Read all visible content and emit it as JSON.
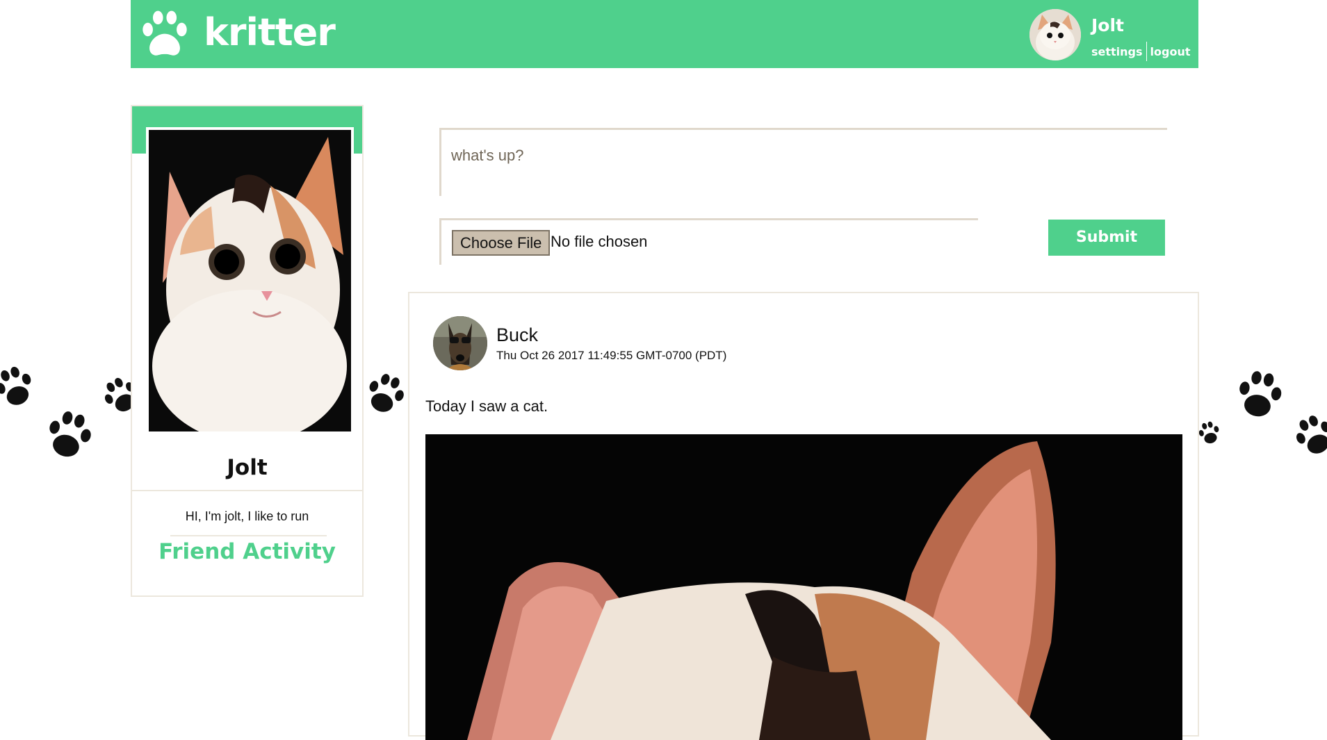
{
  "header": {
    "brand": "kritter",
    "user_name": "Jolt",
    "settings_label": "settings",
    "logout_label": "logout",
    "brand_color": "#4fd08c"
  },
  "profile": {
    "name": "Jolt",
    "bio": "HI, I'm jolt, I like to run",
    "friend_activity_label": "Friend Activity"
  },
  "composer": {
    "status_placeholder": "what's up?",
    "choose_file_label": "Choose File",
    "file_status": "No file chosen",
    "submit_label": "Submit"
  },
  "post": {
    "author": "Buck",
    "timestamp": "Thu Oct 26 2017 11:49:55 GMT-0700 (PDT)",
    "text": "Today I saw a cat."
  },
  "icons": {
    "logo": "paw-icon",
    "background": "paw-print-icon"
  }
}
